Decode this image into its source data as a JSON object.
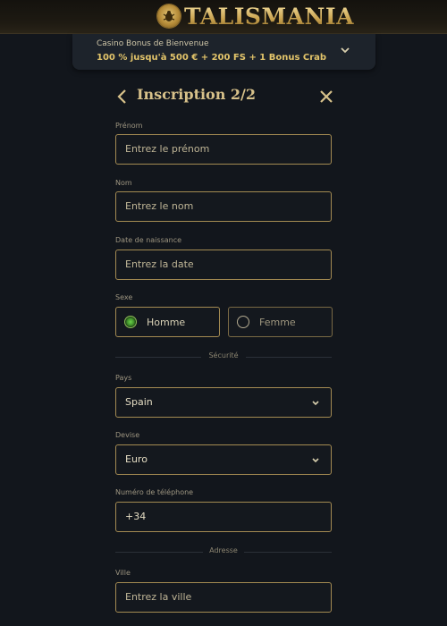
{
  "brand": {
    "name": "TALISMANIA"
  },
  "bonus": {
    "title": "Casino Bonus de Bienvenue",
    "offer": "100 % jusqu'à 500 € + 200 FS + 1 Bonus Crab"
  },
  "form": {
    "title": "Inscription 2/2",
    "first_name": {
      "label": "Prénom",
      "placeholder": "Entrez le prénom"
    },
    "last_name": {
      "label": "Nom",
      "placeholder": "Entrez le nom"
    },
    "birth_date": {
      "label": "Date de naissance",
      "placeholder": "Entrez la date"
    },
    "gender": {
      "label": "Sexe",
      "options": [
        "Homme",
        "Femme"
      ],
      "selected": "Homme"
    },
    "security_divider": "Sécurité",
    "country": {
      "label": "Pays",
      "value": "Spain"
    },
    "currency": {
      "label": "Devise",
      "value": "Euro"
    },
    "phone": {
      "label": "Numéro de téléphone",
      "value": "+34"
    },
    "address_divider": "Adresse",
    "city": {
      "label": "Ville",
      "placeholder": "Entrez la ville"
    }
  },
  "colors": {
    "background": "#12161c",
    "gold_border": "#a48b52",
    "accent_gold": "#e2c46a",
    "radio_selected": "#6bd04a"
  },
  "icons": [
    "back-arrow-icon",
    "close-icon",
    "chevron-down-icon",
    "scarab-logo-icon"
  ]
}
